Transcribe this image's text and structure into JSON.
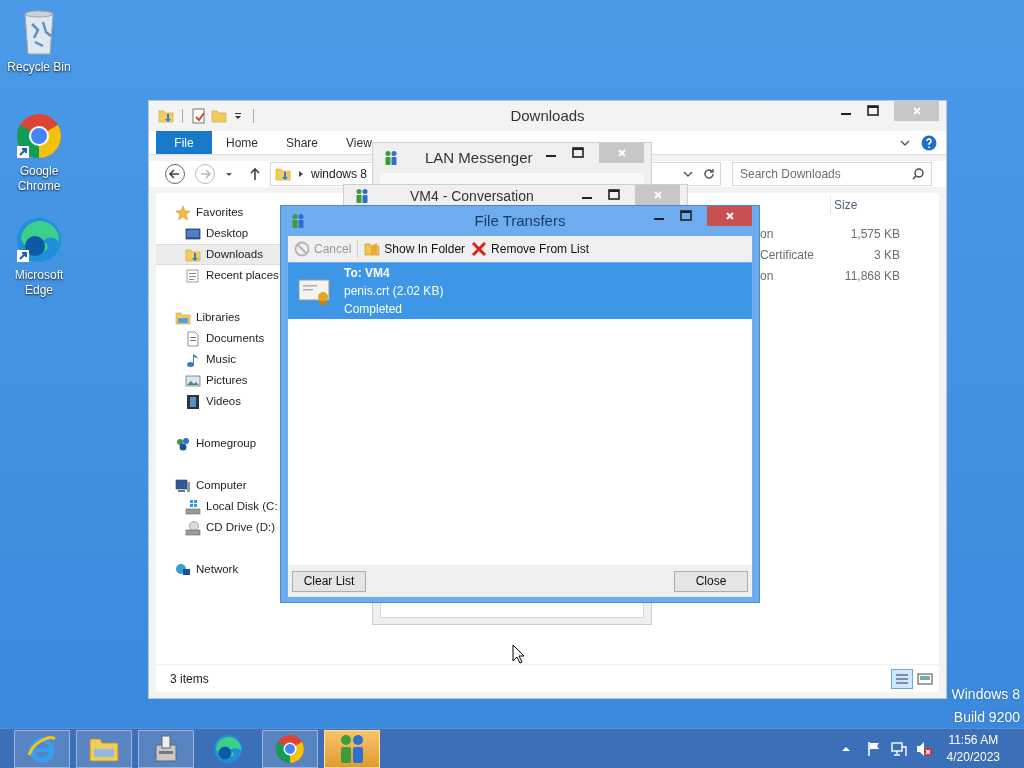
{
  "desktop_icons": [
    {
      "label": "Recycle Bin",
      "kind": "recycle"
    },
    {
      "label": "Google Chrome",
      "kind": "chrome"
    },
    {
      "label": "Microsoft Edge",
      "kind": "edge"
    }
  ],
  "explorer": {
    "title": "Downloads",
    "ribbon_tabs": [
      {
        "label": "File",
        "kind": "backstage"
      },
      {
        "label": "Home",
        "kind": "tab"
      },
      {
        "label": "Share",
        "kind": "tab"
      },
      {
        "label": "View",
        "kind": "tab"
      }
    ],
    "breadcrumb": "windows 8",
    "search_placeholder": "Search Downloads",
    "navigation": [
      {
        "label": "Favorites",
        "kind": "star",
        "selected": false,
        "children": [
          {
            "label": "Desktop",
            "kind": "desktop",
            "selected": false
          },
          {
            "label": "Downloads",
            "kind": "downloads",
            "selected": true
          },
          {
            "label": "Recent places",
            "kind": "recent",
            "selected": false
          }
        ]
      },
      {
        "label": "Libraries",
        "kind": "libraries",
        "selected": false,
        "children": [
          {
            "label": "Documents",
            "kind": "documents",
            "selected": false
          },
          {
            "label": "Music",
            "kind": "music",
            "selected": false
          },
          {
            "label": "Pictures",
            "kind": "pictures",
            "selected": false
          },
          {
            "label": "Videos",
            "kind": "videos",
            "selected": false
          }
        ]
      },
      {
        "label": "Homegroup",
        "kind": "homegroup",
        "selected": false
      },
      {
        "label": "Computer",
        "kind": "computer",
        "selected": false,
        "children": [
          {
            "label": "Local Disk (C:",
            "kind": "disk",
            "selected": false
          },
          {
            "label": "CD Drive (D:)",
            "kind": "cd",
            "selected": false
          }
        ]
      },
      {
        "label": "Network",
        "kind": "network",
        "selected": false
      }
    ],
    "size_column": "Size",
    "files": [
      {
        "type": "on",
        "size": "1,575 KB"
      },
      {
        "type": "Certificate",
        "size": "3 KB"
      },
      {
        "type": "on",
        "size": "11,868 KB"
      }
    ],
    "status": "3 items"
  },
  "lan_messenger": {
    "title": "LAN Messenger"
  },
  "conversation": {
    "title": "VM4 - Conversation"
  },
  "file_transfers": {
    "title": "File Transfers",
    "toolbar": [
      {
        "label": "Cancel",
        "kind": "cancel",
        "disabled": true
      },
      {
        "label": "Show In Folder",
        "kind": "folder",
        "disabled": false
      },
      {
        "label": "Remove From List",
        "kind": "remove",
        "disabled": false
      }
    ],
    "transfers": [
      {
        "recipient": "To: VM4",
        "file": "penis.crt (2.02 KB)",
        "status": "Completed",
        "selected": true
      }
    ],
    "buttons": [
      "Clear List",
      "Close"
    ]
  },
  "os_label": [
    "Windows 8",
    "Build 9200"
  ],
  "taskbar": {
    "apps": [
      {
        "kind": "ie",
        "running": true,
        "active": false
      },
      {
        "kind": "explorer",
        "running": true,
        "active": false
      },
      {
        "kind": "setup",
        "running": true,
        "active": false
      },
      {
        "kind": "edge",
        "running": false,
        "active": false
      },
      {
        "kind": "chrome",
        "running": true,
        "active": false
      },
      {
        "kind": "lan",
        "running": true,
        "active": true
      }
    ],
    "time": "11:56 AM",
    "date": "4/20/2023"
  }
}
